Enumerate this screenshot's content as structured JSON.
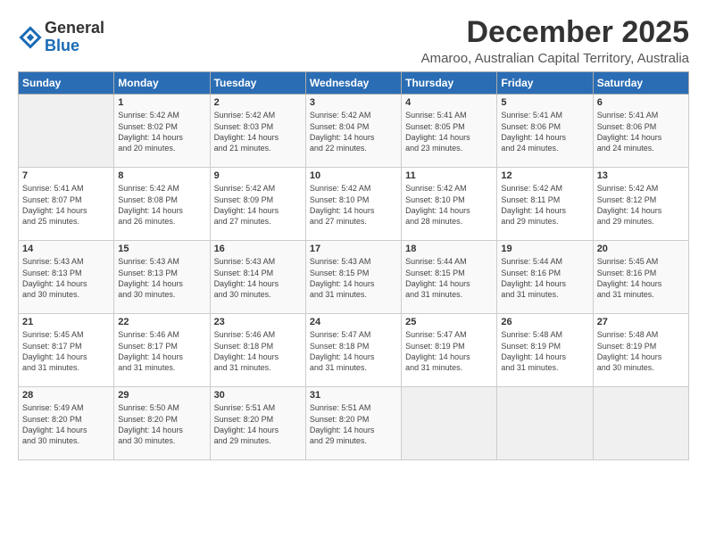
{
  "logo": {
    "general": "General",
    "blue": "Blue"
  },
  "title": "December 2025",
  "location": "Amaroo, Australian Capital Territory, Australia",
  "weekdays": [
    "Sunday",
    "Monday",
    "Tuesday",
    "Wednesday",
    "Thursday",
    "Friday",
    "Saturday"
  ],
  "weeks": [
    [
      {
        "day": "",
        "info": ""
      },
      {
        "day": "1",
        "info": "Sunrise: 5:42 AM\nSunset: 8:02 PM\nDaylight: 14 hours\nand 20 minutes."
      },
      {
        "day": "2",
        "info": "Sunrise: 5:42 AM\nSunset: 8:03 PM\nDaylight: 14 hours\nand 21 minutes."
      },
      {
        "day": "3",
        "info": "Sunrise: 5:42 AM\nSunset: 8:04 PM\nDaylight: 14 hours\nand 22 minutes."
      },
      {
        "day": "4",
        "info": "Sunrise: 5:41 AM\nSunset: 8:05 PM\nDaylight: 14 hours\nand 23 minutes."
      },
      {
        "day": "5",
        "info": "Sunrise: 5:41 AM\nSunset: 8:06 PM\nDaylight: 14 hours\nand 24 minutes."
      },
      {
        "day": "6",
        "info": "Sunrise: 5:41 AM\nSunset: 8:06 PM\nDaylight: 14 hours\nand 24 minutes."
      }
    ],
    [
      {
        "day": "7",
        "info": "Sunrise: 5:41 AM\nSunset: 8:07 PM\nDaylight: 14 hours\nand 25 minutes."
      },
      {
        "day": "8",
        "info": "Sunrise: 5:42 AM\nSunset: 8:08 PM\nDaylight: 14 hours\nand 26 minutes."
      },
      {
        "day": "9",
        "info": "Sunrise: 5:42 AM\nSunset: 8:09 PM\nDaylight: 14 hours\nand 27 minutes."
      },
      {
        "day": "10",
        "info": "Sunrise: 5:42 AM\nSunset: 8:10 PM\nDaylight: 14 hours\nand 27 minutes."
      },
      {
        "day": "11",
        "info": "Sunrise: 5:42 AM\nSunset: 8:10 PM\nDaylight: 14 hours\nand 28 minutes."
      },
      {
        "day": "12",
        "info": "Sunrise: 5:42 AM\nSunset: 8:11 PM\nDaylight: 14 hours\nand 29 minutes."
      },
      {
        "day": "13",
        "info": "Sunrise: 5:42 AM\nSunset: 8:12 PM\nDaylight: 14 hours\nand 29 minutes."
      }
    ],
    [
      {
        "day": "14",
        "info": "Sunrise: 5:43 AM\nSunset: 8:13 PM\nDaylight: 14 hours\nand 30 minutes."
      },
      {
        "day": "15",
        "info": "Sunrise: 5:43 AM\nSunset: 8:13 PM\nDaylight: 14 hours\nand 30 minutes."
      },
      {
        "day": "16",
        "info": "Sunrise: 5:43 AM\nSunset: 8:14 PM\nDaylight: 14 hours\nand 30 minutes."
      },
      {
        "day": "17",
        "info": "Sunrise: 5:43 AM\nSunset: 8:15 PM\nDaylight: 14 hours\nand 31 minutes."
      },
      {
        "day": "18",
        "info": "Sunrise: 5:44 AM\nSunset: 8:15 PM\nDaylight: 14 hours\nand 31 minutes."
      },
      {
        "day": "19",
        "info": "Sunrise: 5:44 AM\nSunset: 8:16 PM\nDaylight: 14 hours\nand 31 minutes."
      },
      {
        "day": "20",
        "info": "Sunrise: 5:45 AM\nSunset: 8:16 PM\nDaylight: 14 hours\nand 31 minutes."
      }
    ],
    [
      {
        "day": "21",
        "info": "Sunrise: 5:45 AM\nSunset: 8:17 PM\nDaylight: 14 hours\nand 31 minutes."
      },
      {
        "day": "22",
        "info": "Sunrise: 5:46 AM\nSunset: 8:17 PM\nDaylight: 14 hours\nand 31 minutes."
      },
      {
        "day": "23",
        "info": "Sunrise: 5:46 AM\nSunset: 8:18 PM\nDaylight: 14 hours\nand 31 minutes."
      },
      {
        "day": "24",
        "info": "Sunrise: 5:47 AM\nSunset: 8:18 PM\nDaylight: 14 hours\nand 31 minutes."
      },
      {
        "day": "25",
        "info": "Sunrise: 5:47 AM\nSunset: 8:19 PM\nDaylight: 14 hours\nand 31 minutes."
      },
      {
        "day": "26",
        "info": "Sunrise: 5:48 AM\nSunset: 8:19 PM\nDaylight: 14 hours\nand 31 minutes."
      },
      {
        "day": "27",
        "info": "Sunrise: 5:48 AM\nSunset: 8:19 PM\nDaylight: 14 hours\nand 30 minutes."
      }
    ],
    [
      {
        "day": "28",
        "info": "Sunrise: 5:49 AM\nSunset: 8:20 PM\nDaylight: 14 hours\nand 30 minutes."
      },
      {
        "day": "29",
        "info": "Sunrise: 5:50 AM\nSunset: 8:20 PM\nDaylight: 14 hours\nand 30 minutes."
      },
      {
        "day": "30",
        "info": "Sunrise: 5:51 AM\nSunset: 8:20 PM\nDaylight: 14 hours\nand 29 minutes."
      },
      {
        "day": "31",
        "info": "Sunrise: 5:51 AM\nSunset: 8:20 PM\nDaylight: 14 hours\nand 29 minutes."
      },
      {
        "day": "",
        "info": ""
      },
      {
        "day": "",
        "info": ""
      },
      {
        "day": "",
        "info": ""
      }
    ]
  ]
}
